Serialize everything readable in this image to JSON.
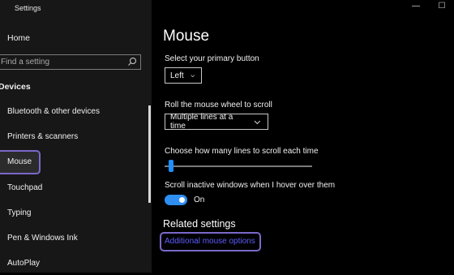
{
  "window": {
    "title": "Settings",
    "controls": {
      "minimize": "—",
      "maximize": "☐"
    }
  },
  "sidebar": {
    "home": "Home",
    "search": {
      "placeholder": "Find a setting",
      "icon": "search-icon"
    },
    "section_title": "Devices",
    "items": [
      {
        "label": "Bluetooth & other devices"
      },
      {
        "label": "Printers & scanners"
      },
      {
        "label": "Mouse",
        "active": true
      },
      {
        "label": "Touchpad"
      },
      {
        "label": "Typing"
      },
      {
        "label": "Pen & Windows Ink"
      },
      {
        "label": "AutoPlay"
      }
    ]
  },
  "main": {
    "title": "Mouse",
    "primary_button": {
      "label": "Select your primary button",
      "value": "Left"
    },
    "scroll_wheel": {
      "label": "Roll the mouse wheel to scroll",
      "value": "Multiple lines at a time"
    },
    "lines_to_scroll": {
      "label": "Choose how many lines to scroll each time",
      "level": 0.03
    },
    "scroll_inactive": {
      "label": "Scroll inactive windows when I hover over them",
      "state_label": "On",
      "on": true
    },
    "related": {
      "title": "Related settings",
      "link": "Additional mouse options"
    }
  },
  "colors": {
    "accent": "#2f8ef2",
    "highlight": "#7b68c9",
    "link": "#5d5dff"
  }
}
